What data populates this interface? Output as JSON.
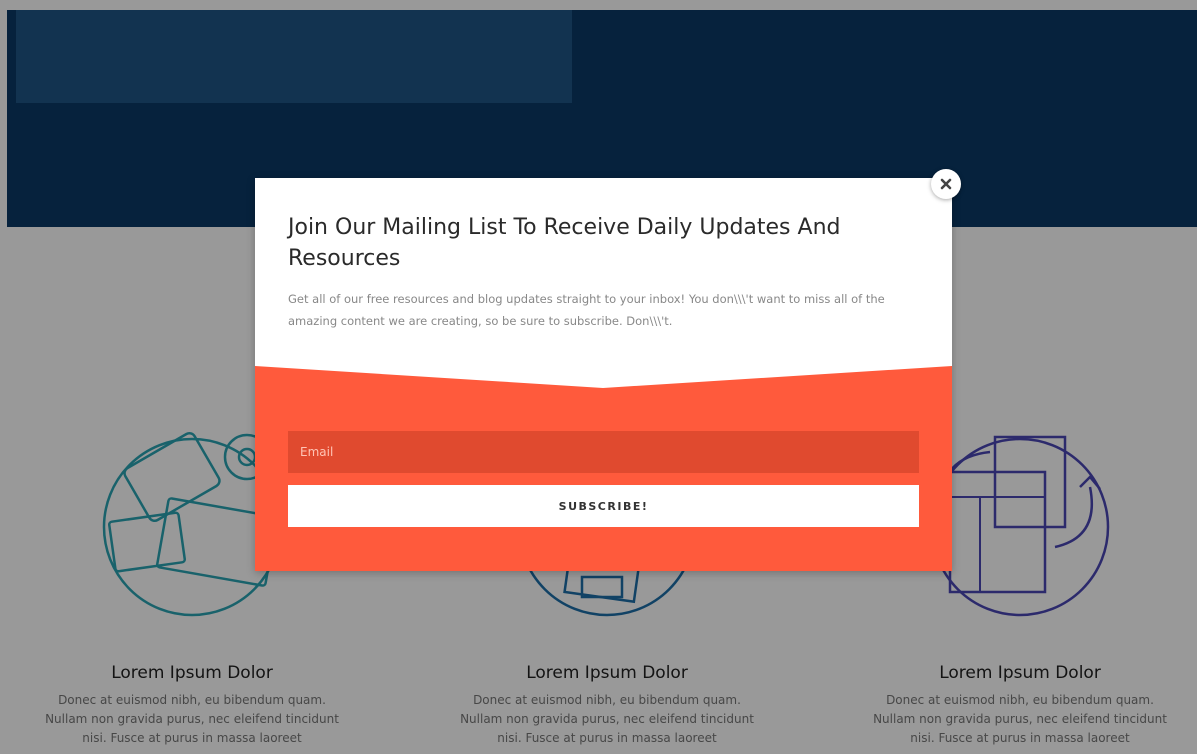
{
  "features": [
    {
      "title": "Lorem Ipsum Dolor",
      "text_lines": [
        "Donec at euismod nibh, eu bibendum quam.",
        "Nullam non gravida purus, nec eleifend tincidunt",
        "nisi. Fusce at purus in massa laoreet"
      ],
      "icon": "devices-illustration-icon",
      "color": "#2aa3b3"
    },
    {
      "title": "Lorem Ipsum Dolor",
      "text_lines": [
        "Donec at euismod nibh, eu bibendum quam.",
        "Nullam non gravida purus, nec eleifend tincidunt",
        "nisi. Fusce at purus in massa laoreet"
      ],
      "icon": "layout-illustration-icon",
      "color": "#1d6fa8"
    },
    {
      "title": "Lorem Ipsum Dolor",
      "text_lines": [
        "Donec at euismod nibh, eu bibendum quam.",
        "Nullam non gravida purus, nec eleifend tincidunt",
        "nisi. Fusce at purus in massa laoreet"
      ],
      "icon": "sync-illustration-icon",
      "color": "#4a46b5"
    }
  ],
  "popup": {
    "title": "Join Our Mailing List To Receive Daily Updates And Resources",
    "description": "Get all of our free resources and blog updates straight to your inbox! You don\\\\\\'t want to miss all of the amazing content we are creating, so be sure to subscribe. Don\\\\\\'t.",
    "email_placeholder": "Email",
    "email_value": "",
    "subscribe_label": "SUBSCRIBE!",
    "close_icon": "close-icon"
  },
  "colors": {
    "hero": "#0a3a66",
    "hero_panel": "#1f5585",
    "accent": "#ff5a3c",
    "input_bg": "#e04a2f"
  }
}
